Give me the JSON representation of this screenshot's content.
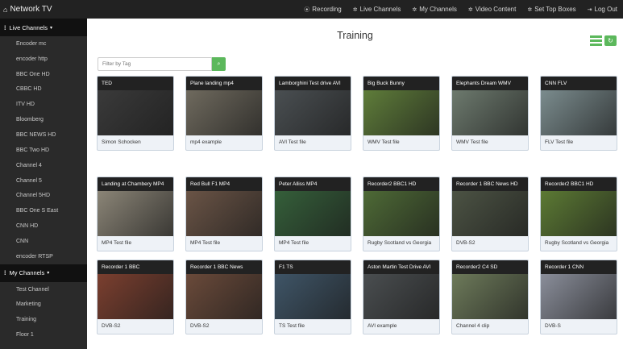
{
  "app": {
    "title": "Network TV",
    "home_icon": "home-icon"
  },
  "topnav": [
    {
      "label": "Recording",
      "icon": "record-icon",
      "glyph": "⦿"
    },
    {
      "label": "Live Channels",
      "icon": "gear-icon",
      "glyph": "✲"
    },
    {
      "label": "My Channels",
      "icon": "gear-icon",
      "glyph": "✲"
    },
    {
      "label": "Video Content",
      "icon": "gear-icon",
      "glyph": "✲"
    },
    {
      "label": "Set Top Boxes",
      "icon": "gear-icon",
      "glyph": "✲"
    },
    {
      "label": "Log Out",
      "icon": "logout-icon",
      "glyph": "⇥"
    }
  ],
  "sidebar": {
    "live_group": {
      "label": "Live Channels"
    },
    "live_items": [
      "Encoder mc",
      "encoder http",
      "BBC One HD",
      "CBBC HD",
      "ITV HD",
      "Bloomberg",
      "BBC NEWS HD",
      "BBC Two HD",
      "Channel 4",
      "Channel 5",
      "Channel 5HD",
      "BBC One S East",
      "CNN HD",
      "CNN",
      "encoder RTSP"
    ],
    "my_group": {
      "label": "My Channels"
    },
    "my_items": [
      "Test Channel",
      "Marketing",
      "Training",
      "Floor 1"
    ]
  },
  "main": {
    "title": "Training",
    "filter_placeholder": "Filter by Tag"
  },
  "colors": {
    "accent": "#5cb85c",
    "topbar": "#222222",
    "sidebar": "#2a2a2a",
    "card_head": "#222222",
    "card_body": "#eef2f7"
  },
  "cards": [
    {
      "title": "TED",
      "desc": "Simon Schocken",
      "thumb": "#3a3a3a"
    },
    {
      "title": "Plane landing mp4",
      "desc": "mp4 example",
      "thumb": "#6f6a5e"
    },
    {
      "title": "Lamborghini Test drive AVI",
      "desc": "AVI Test file",
      "thumb": "#4a4f52"
    },
    {
      "title": "Big Buck Bunny",
      "desc": "WMV Test file",
      "thumb": "#5f7d3a"
    },
    {
      "title": "Elephants Dream WMV",
      "desc": "WMV Test file",
      "thumb": "#6d7a6e"
    },
    {
      "title": "CNN FLV",
      "desc": "FLV Test file",
      "thumb": "#7b8c8e"
    },
    {
      "title": "Landing at Chambery MP4",
      "desc": "MP4 Test file",
      "thumb": "#8b8577"
    },
    {
      "title": "Red Bull F1 MP4",
      "desc": "MP4 Test file",
      "thumb": "#6a5446"
    },
    {
      "title": "Peter Alliss MP4",
      "desc": "MP4 Test file",
      "thumb": "#355f3a"
    },
    {
      "title": "Recorder2 BBC1 HD",
      "desc": "Rugby Scotland vs Georgia",
      "thumb": "#4e6a36"
    },
    {
      "title": "Recorder 1 BBC News HD",
      "desc": "DVB-S2",
      "thumb": "#4c5344"
    },
    {
      "title": "Recorder2 BBC1 HD",
      "desc": "Rugby Scotland vs Georgia",
      "thumb": "#5c7a34"
    },
    {
      "title": "Recorder 1 BBC",
      "desc": "DVB-S2",
      "thumb": "#7b3f2f"
    },
    {
      "title": "Recorder 1 BBC News",
      "desc": "DVB-S2",
      "thumb": "#6a4a3a"
    },
    {
      "title": "F1 TS",
      "desc": "TS Test file",
      "thumb": "#3f5567"
    },
    {
      "title": "Aston Martin Test Drive AVI",
      "desc": "AVI example",
      "thumb": "#4a4e50"
    },
    {
      "title": "Recorder2 C4 SD",
      "desc": "Channel 4 clip",
      "thumb": "#6d7a5a"
    },
    {
      "title": "Recorder 1 CNN",
      "desc": "DVB-S",
      "thumb": "#8a8e9a"
    }
  ]
}
